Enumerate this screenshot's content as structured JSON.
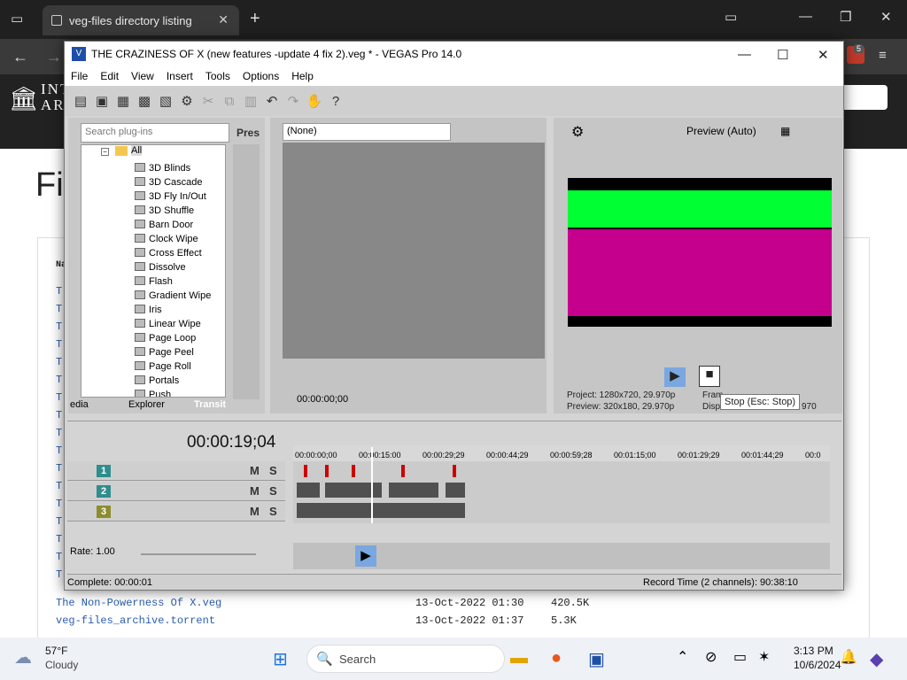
{
  "browser": {
    "tab_title": "veg-files directory listing",
    "page_title": "Fi"
  },
  "archive": {
    "logo_text": "INT\nARC"
  },
  "listing": {
    "rows": [
      {
        "name": "The Non-Powerness Of X.veg",
        "date": "13-Oct-2022 01:30",
        "size": "420.5K"
      },
      {
        "name": "veg-files_archive.torrent",
        "date": "13-Oct-2022 01:37",
        "size": "5.3K"
      }
    ],
    "header": "Na",
    "partials": [
      "T",
      "T",
      "T",
      "T",
      "T",
      "T",
      "T",
      "T",
      "T",
      "T",
      "T",
      "T",
      "T",
      "T",
      "T",
      "T",
      "T"
    ]
  },
  "vegas": {
    "title": "THE CRAZINESS OF X (new features -update 4 fix 2).veg * - VEGAS Pro 14.0",
    "menu": [
      "File",
      "Edit",
      "View",
      "Insert",
      "Tools",
      "Options",
      "Help"
    ],
    "search_placeholder": "Search plug-ins",
    "presets_label": "Pres",
    "tree_root": "All",
    "transitions": [
      "3D Blinds",
      "3D Cascade",
      "3D Fly In/Out",
      "3D Shuffle",
      "Barn Door",
      "Clock Wipe",
      "Cross Effect",
      "Dissolve",
      "Flash",
      "Gradient Wipe",
      "Iris",
      "Linear Wipe",
      "Page Loop",
      "Page Peel",
      "Page Roll",
      "Portals",
      "Push"
    ],
    "panel_tabs": [
      "edia",
      "Explorer",
      "Transit"
    ],
    "trimmer_select": "(None)",
    "trimmer_time": "00:00:00;00",
    "preview_mode": "Preview (Auto)",
    "project_info": "Project:  1280x720, 29.970p",
    "preview_info": "Preview:  320x180, 29.970p",
    "frame_label": "Fram",
    "disp_label": "Disp",
    "disp_value": "970",
    "stop_tooltip": "Stop (Esc: Stop)",
    "timecode": "00:00:19;04",
    "ruler": [
      "00:00:00;00",
      "00:00:15:00",
      "00:00:29;29",
      "00:00:44;29",
      "00:00:59;28",
      "00:01:15;00",
      "00:01:29;29",
      "00:01:44;29",
      "00:0"
    ],
    "tracks": [
      {
        "num": "1",
        "color": "#2f8d8d"
      },
      {
        "num": "2",
        "color": "#2f8d8d"
      },
      {
        "num": "3",
        "color": "#8d8d2f"
      }
    ],
    "rate": "Rate: 1.00",
    "complete": "Complete: 00:00:01",
    "record_time": "Record Time (2 channels): 90:38:10",
    "ms_labels": [
      "M",
      "S"
    ]
  },
  "taskbar": {
    "temp": "57°F",
    "weather": "Cloudy",
    "search": "Search",
    "time": "3:13 PM",
    "date": "10/6/2024",
    "badge": "5"
  }
}
